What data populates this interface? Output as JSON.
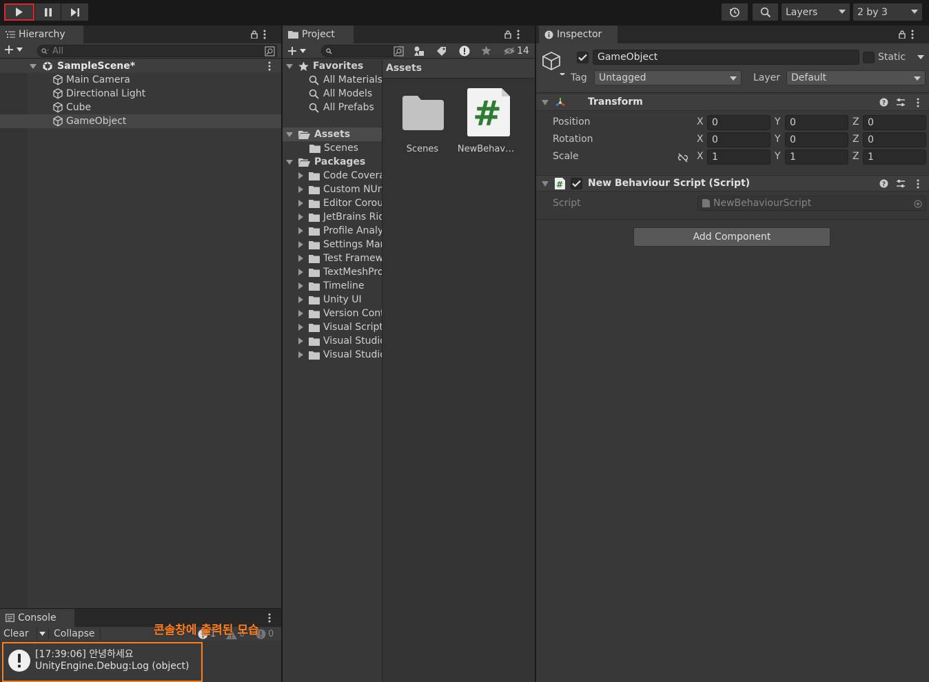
{
  "toolbar": {
    "layers_label": "Layers",
    "layout_label": "2 by 3"
  },
  "hierarchy": {
    "tab_label": "Hierarchy",
    "search_placeholder": "All",
    "scene_name": "SampleScene*",
    "items": [
      "Main Camera",
      "Directional Light",
      "Cube",
      "GameObject"
    ],
    "selected_index": 3
  },
  "console": {
    "tab_label": "Console",
    "clear_label": "Clear",
    "collapse_label": "Collapse",
    "log_count": "1",
    "warning_count": "0",
    "error_count": "0",
    "entry_line1": "[17:39:06] 안녕하세요",
    "entry_line2": "UnityEngine.Debug:Log (object)",
    "annotation": "콘솔창에 출력된 모습",
    "annotation_color": "#ff7f1f"
  },
  "project": {
    "tab_label": "Project",
    "hidden_count": "14",
    "favorites_label": "Favorites",
    "favorites": [
      "All Materials",
      "All Models",
      "All Prefabs"
    ],
    "assets_label": "Assets",
    "assets_children": [
      "Scenes"
    ],
    "packages_label": "Packages",
    "packages": [
      "Code Coverage",
      "Custom NUnit",
      "Editor Coroutines",
      "JetBrains Rider Editor",
      "Profile Analyzer",
      "Settings Manager",
      "Test Framework",
      "TextMeshPro",
      "Timeline",
      "Unity UI",
      "Version Control",
      "Visual Scripting",
      "Visual Studio Code Editor",
      "Visual Studio Editor"
    ],
    "breadcrumb": "Assets",
    "grid_items": [
      {
        "name": "Scenes",
        "icon": "folder-icon"
      },
      {
        "name": "NewBehav…",
        "icon": "csharp-script-icon"
      }
    ]
  },
  "inspector": {
    "tab_label": "Inspector",
    "object_name": "GameObject",
    "active": true,
    "static_label": "Static",
    "tag_label": "Tag",
    "tag_value": "Untagged",
    "layer_label": "Layer",
    "layer_value": "Default",
    "transform": {
      "title": "Transform",
      "position_label": "Position",
      "rotation_label": "Rotation",
      "scale_label": "Scale",
      "x_label": "X",
      "y_label": "Y",
      "z_label": "Z",
      "position": [
        "0",
        "0",
        "0"
      ],
      "rotation": [
        "0",
        "0",
        "0"
      ],
      "scale": [
        "1",
        "1",
        "1"
      ]
    },
    "script_component": {
      "title": "New Behaviour Script (Script)",
      "script_label": "Script",
      "script_value": "NewBehaviourScript"
    },
    "add_component_label": "Add Component"
  },
  "colors": {
    "play_highlight": "#e0242b",
    "console_highlight": "#ff7f1f",
    "selection": "#454545"
  }
}
